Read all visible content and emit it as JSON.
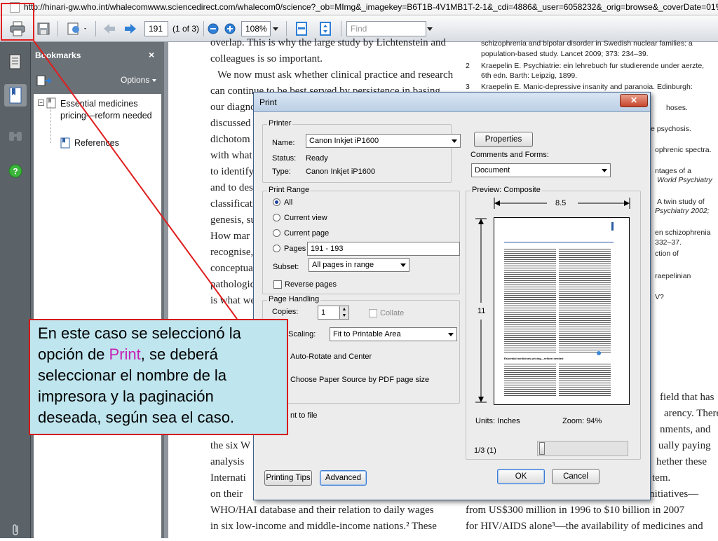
{
  "browser": {
    "url": "http://hinari-gw.who.int/whalecomwww.sciencedirect.com/whalecom0/science?_ob=MImg&_imagekey=B6T1B-4V1MB1T-2-1&_cdi=4886&_user=6058232&_orig=browse&_coverDate=01%2"
  },
  "toolbar": {
    "page_number": "191",
    "page_of": "(1 of 3)",
    "zoom": "108%",
    "find_placeholder": "Find"
  },
  "bookmarks": {
    "title": "Bookmarks",
    "close": "×",
    "options": "Options",
    "items": [
      {
        "label": "Essential medicines pricing—reform needed"
      },
      {
        "label": "References"
      }
    ]
  },
  "document": {
    "left_lines": [
      "overlap. This is why the large study by Lichtenstein and",
      "colleagues is so important.",
      "We now must ask whether clinical practice and research",
      "can continue to be best served by persistence in basing",
      "our diagnoses",
      "discussed",
      "dichotom",
      "with what",
      "to identify",
      "and to des",
      "classificati",
      "genesis, su",
      "How mar",
      "recognise,",
      "conceptua",
      "pathologic",
      "is what we",
      "the six W",
      "analysis",
      "Internati",
      "on their",
      "WHO/HAI database and their relation to daily wages",
      "in six low-income and middle-income nations.² These"
    ],
    "right_lines": [
      "schizophrenia and bipolar disorder in Swedish nuclear families: a",
      "population-based study. Lancet 2009; 373: 234–39.",
      "Kraepelin E. Psychiatrie: ein lehrebuch fur studierende under aerzte,",
      "6th edn. Barth: Leipzig, 1899.",
      "Kraepelin E. Manic-depressive insanity and paranoia. Edinburgh:",
      "hoses.",
      "e psychosis.",
      "ophrenic spectra.",
      "ntages of a",
      "World Psychiatry",
      "A twin study of",
      "Psychiatry 2002;",
      "en schizophrenia",
      "332–37.",
      "ction of",
      "raepelinian",
      "V?",
      "field that has",
      "arency. There",
      "nments, and",
      "ually paying",
      "hether these",
      "tem.",
      "initiatives—",
      "from US$300 million in 1996 to $10 billion in 2007",
      "for HIV/AIDS alone³—the availability of medicines and"
    ],
    "ref_numbers": [
      "2",
      "3"
    ]
  },
  "dialog": {
    "title": "Print",
    "printer": {
      "group": "Printer",
      "name_label": "Name:",
      "name_value": "Canon Inkjet iP1600",
      "status_label": "Status:",
      "status_value": "Ready",
      "type_label": "Type:",
      "type_value": "Canon Inkjet iP1600",
      "properties": "Properties",
      "comments_label": "Comments and Forms:",
      "comments_value": "Document"
    },
    "range": {
      "group": "Print Range",
      "all": "All",
      "current_view": "Current view",
      "current_page": "Current page",
      "pages": "Pages",
      "pages_value": "191 - 193",
      "subset_label": "Subset:",
      "subset_value": "All pages in range",
      "reverse": "Reverse pages"
    },
    "handling": {
      "group": "Page Handling",
      "copies_label": "Copies:",
      "copies_value": "1",
      "collate": "Collate",
      "scaling_label": "e Scaling:",
      "scaling_value": "Fit to Printable Area",
      "autorotate": "Auto-Rotate and Center",
      "paper_source": "Choose Paper Source by PDF page size",
      "print_to_file": "nt to file"
    },
    "preview": {
      "group": "Preview: Composite",
      "width": "8.5",
      "height": "11",
      "units": "Units: Inches",
      "zoom": "Zoom:  94%",
      "page": "1/3 (1)",
      "thumb_heading": "Essential medicines pricing—reform needed"
    },
    "buttons": {
      "tips": "Printing Tips",
      "advanced": "Advanced",
      "ok": "OK",
      "cancel": "Cancel"
    }
  },
  "callout": {
    "before": "En este caso se seleccionó la opción de ",
    "highlight": "Print",
    "after": ", se deberá seleccionar el nombre de la impresora y la paginación deseada, según sea el caso.",
    "highlight_color": "#c81eb4"
  },
  "colors": {
    "annotation_red": "#e01e1e",
    "callout_bg": "#bfe5ee",
    "sidebar": "#5b6268"
  }
}
